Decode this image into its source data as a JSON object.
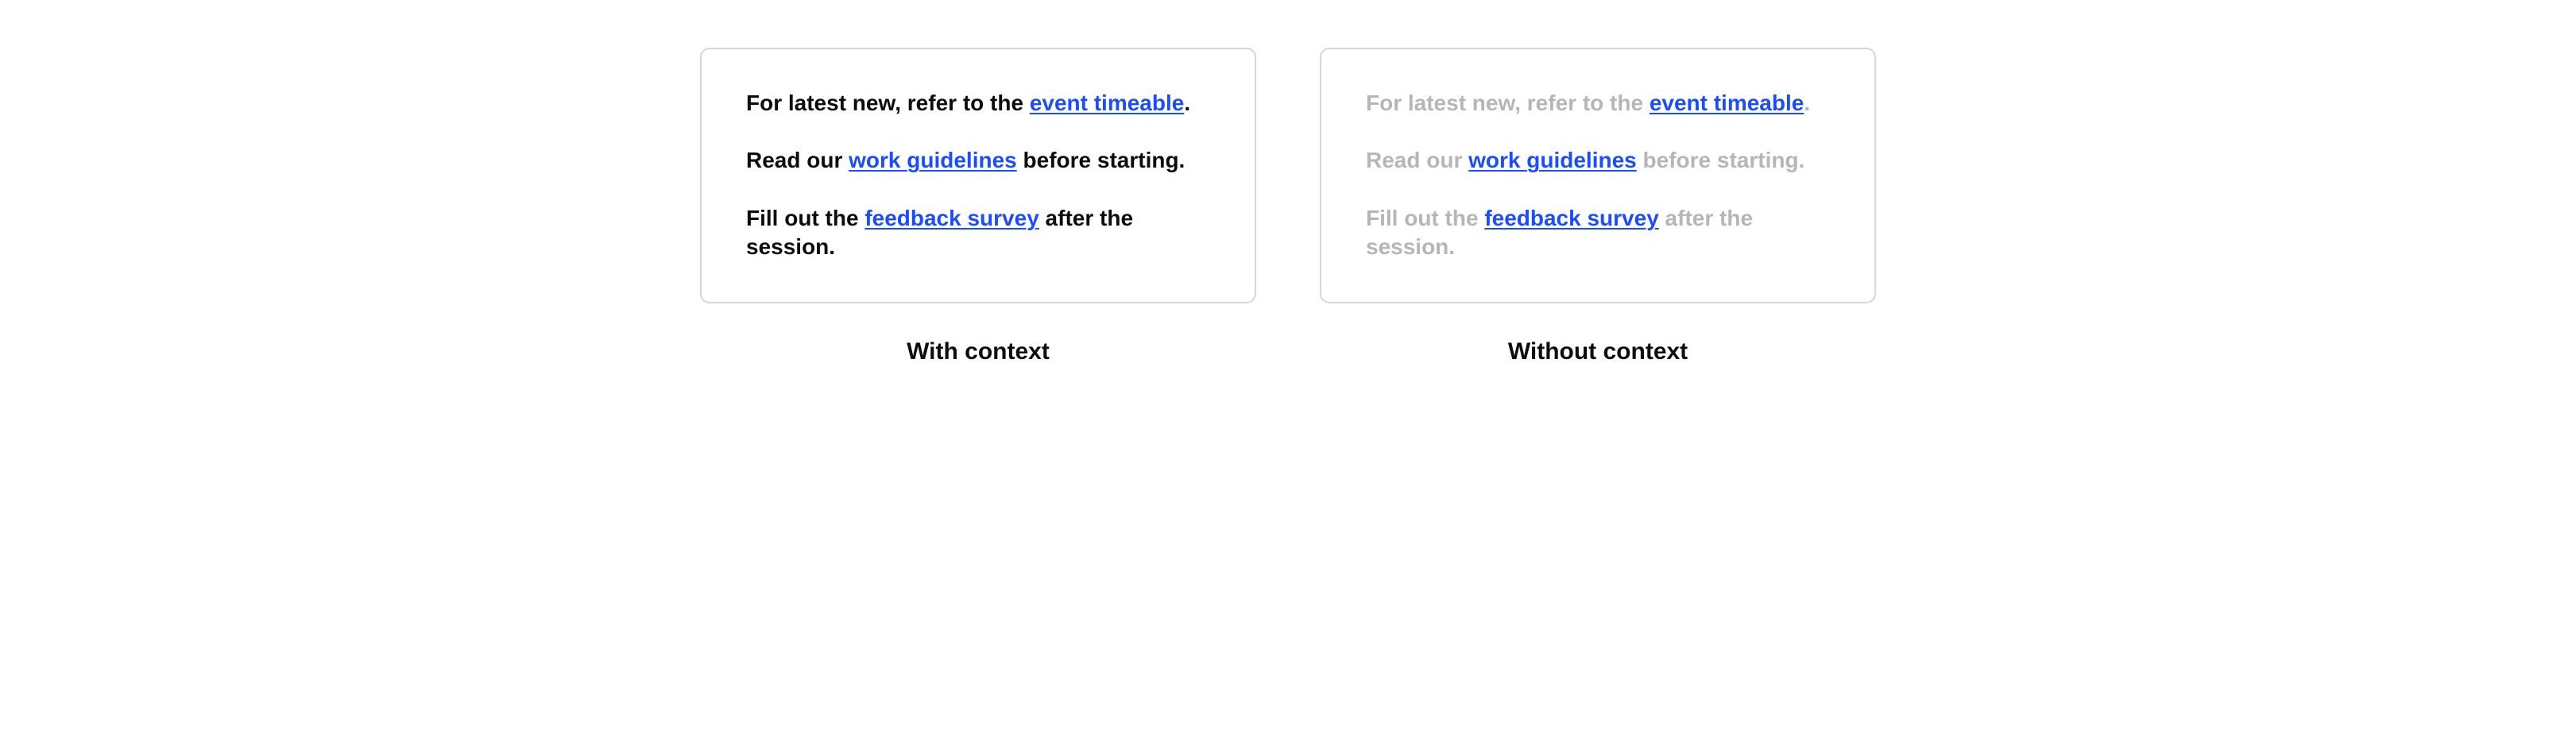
{
  "examples": {
    "with_context": {
      "caption": "With context",
      "lines": [
        {
          "pre": "For latest new, refer to the ",
          "link": "event timeable",
          "post": "."
        },
        {
          "pre": "Read our ",
          "link": "work guidelines",
          "post": " before starting."
        },
        {
          "pre": "Fill out the ",
          "link": "feedback survey",
          "post": " after the session."
        }
      ]
    },
    "without_context": {
      "caption": "Without context",
      "lines": [
        {
          "pre": "For latest new, refer to the ",
          "link": "event timeable",
          "post": "."
        },
        {
          "pre": "Read our ",
          "link": "work guidelines",
          "post": " before starting."
        },
        {
          "pre": "Fill out the ",
          "link": "feedback survey",
          "post": " after the session."
        }
      ]
    }
  }
}
